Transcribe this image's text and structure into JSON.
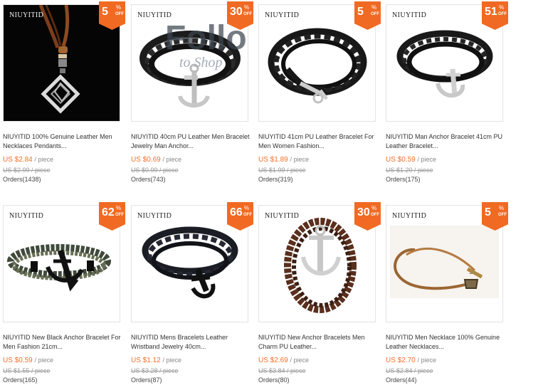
{
  "products": [
    {
      "brand": "NIUYITID",
      "discount_num": "5",
      "discount_symbol": "%",
      "discount_off": "OFF",
      "title": "NIUYITID 100% Genuine Leather Men Necklaces Pendants...",
      "price": "US $2.84",
      "unit": "/ piece",
      "old_price": "US $2.99 / piece",
      "orders": "Orders(1438)",
      "icon": "pendant-necklace-image"
    },
    {
      "brand": "NIUYITID",
      "discount_num": "30",
      "discount_symbol": "%",
      "discount_off": "OFF",
      "title": "NIUYITID 40cm PU Leather Men Bracelet Jewelry Man Anchor...",
      "price": "US $0.69",
      "unit": "/ piece",
      "old_price": "US $0.99 / piece",
      "orders": "Orders(743)",
      "icon": "anchor-bracelet-image"
    },
    {
      "brand": "NIUYITID",
      "discount_num": "5",
      "discount_symbol": "%",
      "discount_off": "OFF",
      "title": "NIUYITID 41cm PU Leather Bracelet For Men Women Fashion...",
      "price": "US $1.89",
      "unit": "/ piece",
      "old_price": "US $1.99 / piece",
      "orders": "Orders(319)",
      "icon": "braided-bracelet-image"
    },
    {
      "brand": "NIUYITID",
      "discount_num": "51",
      "discount_symbol": "%",
      "discount_off": "OFF",
      "title": "NIUYITID Man Anchor Bracelet 41cm PU Leather Bracelet...",
      "price": "US $0.59",
      "unit": "/ piece",
      "old_price": "US $1.20 / piece",
      "orders": "Orders(175)",
      "icon": "anchor-bracelet-image"
    },
    {
      "brand": "NIUYITID",
      "discount_num": "62",
      "discount_symbol": "%",
      "discount_off": "OFF",
      "title": "NIUYITID New Black Anchor Bracelet For Men Fashion 21cm...",
      "price": "US $0.59",
      "unit": "/ piece",
      "old_price": "US $1.55 / piece",
      "orders": "Orders(165)",
      "icon": "rope-anchor-bracelet-image"
    },
    {
      "brand": "NIUYITID",
      "discount_num": "66",
      "discount_symbol": "%",
      "discount_off": "OFF",
      "title": "NIUYITID Mens Bracelets Leather Wristband Jewelry 40cm...",
      "price": "US $1.12",
      "unit": "/ piece",
      "old_price": "US $3.28 / piece",
      "orders": "Orders(87)",
      "icon": "anchor-bracelet-image"
    },
    {
      "brand": "NIUYITID",
      "discount_num": "30",
      "discount_symbol": "%",
      "discount_off": "OFF",
      "title": "NIUYITID New Anchor Bracelets Men Charm PU Leather...",
      "price": "US $2.69",
      "unit": "/ piece",
      "old_price": "US $3.84 / piece",
      "orders": "Orders(80)",
      "icon": "brown-anchor-bracelet-image"
    },
    {
      "brand": "NIUYITID",
      "discount_num": "5",
      "discount_symbol": "%",
      "discount_off": "OFF",
      "title": "NIUYITID Men Necklace 100% Genuine Leather Necklaces...",
      "price": "US $2.70",
      "unit": "/ piece",
      "old_price": "US $2.84 / piece",
      "orders": "Orders(44)",
      "icon": "leather-cord-necklace-image"
    }
  ],
  "watermark": {
    "line1": "Follo",
    "line2": "to Shop"
  },
  "colors": {
    "accent": "#f06a23",
    "price": "#f36f28"
  }
}
